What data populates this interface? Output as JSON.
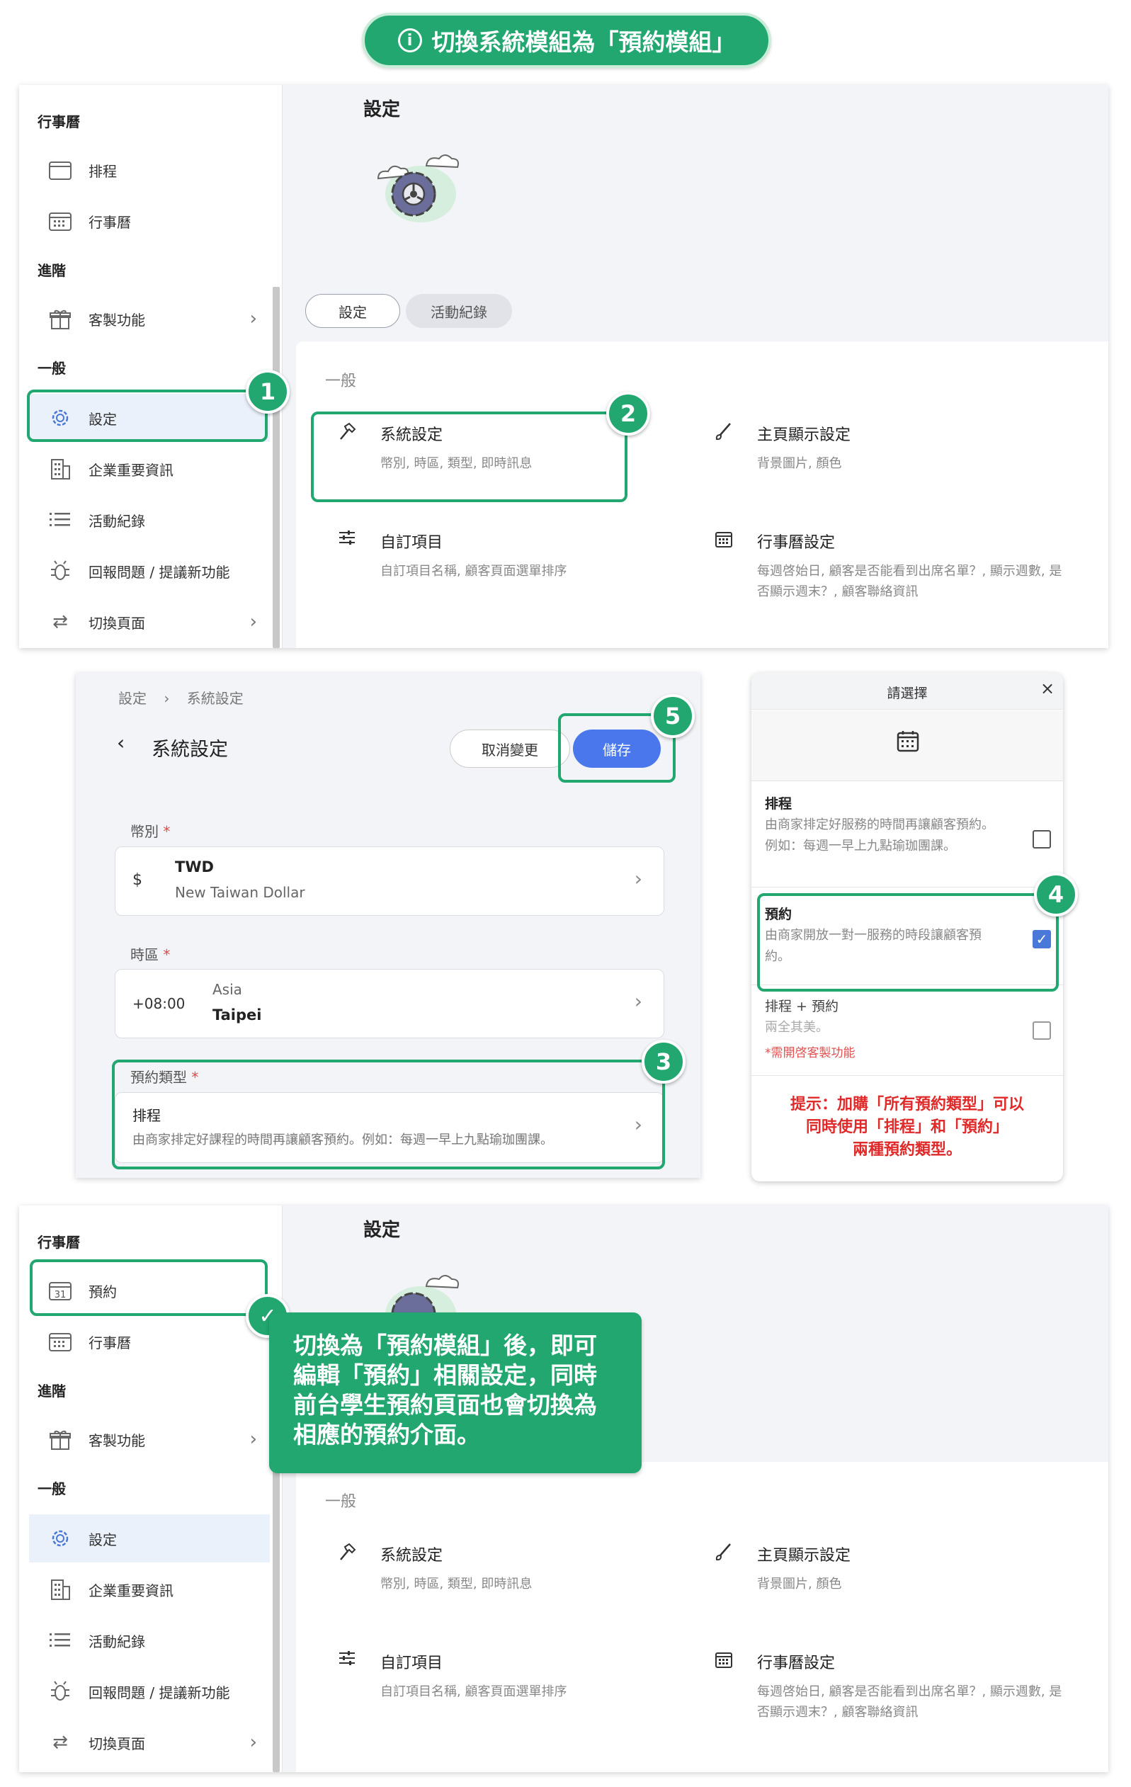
{
  "banner": {
    "title": "切換系統模組為「預約模組」"
  },
  "sidebar_top": {
    "sections": {
      "calendar": "行事曆",
      "advanced": "進階",
      "general": "一般"
    },
    "items": [
      {
        "label": "排程"
      },
      {
        "label": "行事曆"
      },
      {
        "label": "客製功能"
      },
      {
        "label": "設定"
      },
      {
        "label": "企業重要資訊"
      },
      {
        "label": "活動紀錄"
      },
      {
        "label": "回報問題 / 提議新功能"
      },
      {
        "label": "切換頁面"
      }
    ]
  },
  "main_top": {
    "title": "設定",
    "tabs": [
      {
        "label": "設定"
      },
      {
        "label": "活動紀錄"
      }
    ],
    "section": "一般",
    "options": [
      {
        "title": "系統設定",
        "sub": "幣別, 時區, 類型, 即時訊息"
      },
      {
        "title": "主頁顯示設定",
        "sub": "背景圖片, 顏色"
      },
      {
        "title": "自訂項目",
        "sub": "自訂項目名稱, 顧客頁面選單排序"
      },
      {
        "title": "行事曆設定",
        "sub": "每週啓始日, 顧客是否能看到出席名單？, 顯示週數, 是否顯示週末？, 顧客聯絡資訊"
      }
    ]
  },
  "system_settings": {
    "breadcrumb": {
      "root": "設定",
      "current": "系統設定"
    },
    "title": "系統設定",
    "cancel_label": "取消變更",
    "save_label": "儲存",
    "currency": {
      "label": "幣別",
      "required": "*",
      "symbol": "$",
      "code": "TWD",
      "name": "New Taiwan Dollar"
    },
    "timezone": {
      "label": "時區",
      "required": "*",
      "offset": "+08:00",
      "region": "Asia",
      "city": "Taipei"
    },
    "booking_type": {
      "label": "預約類型",
      "required": "*",
      "value": "排程",
      "desc": "由商家排定好課程的時間再讓顧客預約。例如：每週一早上九點瑜珈團課。"
    }
  },
  "modal": {
    "title": "請選擇",
    "options": [
      {
        "title": "排程",
        "desc": "由商家排定好服務的時間再讓顧客預約。例如：每週一早上九點瑜珈團課。",
        "checked": false
      },
      {
        "title": "預約",
        "desc": "由商家開放一對一服務的時段讓顧客預約。",
        "checked": true
      },
      {
        "title": "排程 + 預約",
        "desc": "兩全其美。",
        "note": "*需開啓客製功能",
        "checked": false
      }
    ],
    "tip_lines": [
      "提示：加購「所有預約類型」可以",
      "同時使用「排程」和「預約」",
      "兩種預約類型。"
    ]
  },
  "sidebar_bottom": {
    "sections": {
      "calendar": "行事曆",
      "advanced": "進階",
      "general": "一般"
    },
    "items": [
      {
        "label": "預約",
        "day": "31"
      },
      {
        "label": "行事曆"
      },
      {
        "label": "客製功能"
      },
      {
        "label": "設定"
      },
      {
        "label": "企業重要資訊"
      },
      {
        "label": "活動紀錄"
      },
      {
        "label": "回報問題 / 提議新功能"
      },
      {
        "label": "切換頁面"
      }
    ]
  },
  "callout": {
    "text": "切換為「預約模組」後，即可編輯「預約」相關設定，同時前台學生預約頁面也會切換為相應的預約介面。"
  },
  "badges": [
    "1",
    "2",
    "3",
    "4",
    "5"
  ],
  "colors": {
    "accent_green": "#21a76f",
    "primary_blue": "#4a78d8",
    "tip_red": "#e02a2a"
  }
}
